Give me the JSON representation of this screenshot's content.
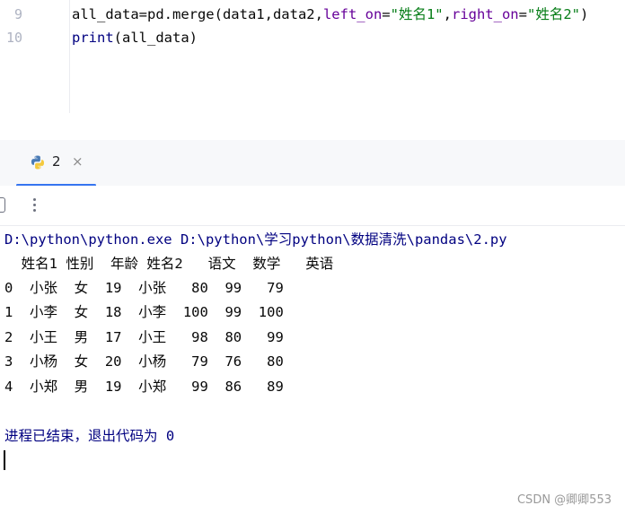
{
  "editor": {
    "lines": [
      {
        "number": "9",
        "segments": [
          {
            "text": "all_data=pd.merge(data1,data2,",
            "cls": ""
          },
          {
            "text": "left_on",
            "cls": "kw-param"
          },
          {
            "text": "=",
            "cls": ""
          },
          {
            "text": "\"姓名1\"",
            "cls": "str"
          },
          {
            "text": ",",
            "cls": ""
          },
          {
            "text": "right_on",
            "cls": "kw-param"
          },
          {
            "text": "=",
            "cls": ""
          },
          {
            "text": "\"姓名2\"",
            "cls": "str"
          },
          {
            "text": ")",
            "cls": ""
          }
        ]
      },
      {
        "number": "10",
        "segments": [
          {
            "text": "print",
            "cls": "fn"
          },
          {
            "text": "(all_data)",
            "cls": ""
          }
        ]
      }
    ]
  },
  "run_tab": {
    "label": "2",
    "icon": "python-icon",
    "close_glyph": "×"
  },
  "toolbar": {
    "more_icon": "more-vertical-icon"
  },
  "console": {
    "command": "D:\\python\\python.exe D:\\python\\学习python\\数据清洗\\pandas\\2.py",
    "header": "  姓名1 性别  年龄 姓名2   语文  数学   英语",
    "rows": [
      "0  小张  女  19  小张   80  99   79",
      "1  小李  女  18  小李  100  99  100",
      "2  小王  男  17  小王   98  80   99",
      "3  小杨  女  20  小杨   79  76   80",
      "4  小郑  男  19  小郑   99  86   89"
    ],
    "exit_message": "进程已结束，退出代码为 0"
  },
  "watermark": "CSDN @卿卿553",
  "colors": {
    "accent": "#3574f0",
    "command_text": "#000080",
    "string": "#067d17",
    "keyword_param": "#660099"
  }
}
